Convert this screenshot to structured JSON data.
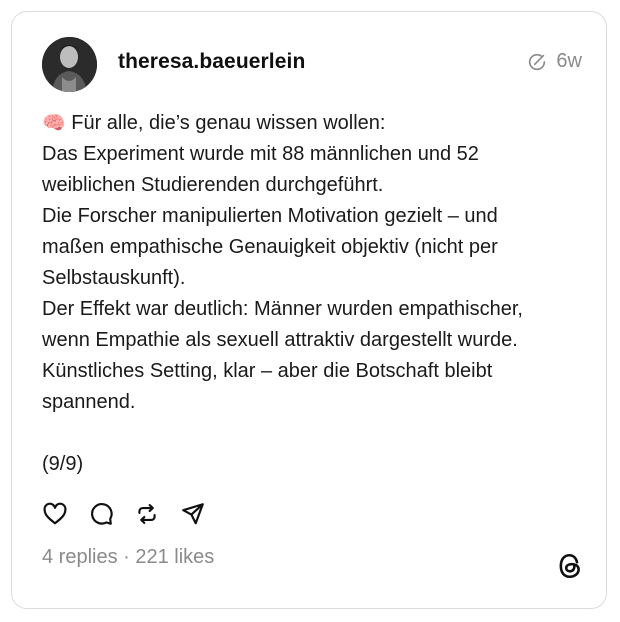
{
  "post": {
    "username": "theresa.baeuerlein",
    "time_ago": "6w",
    "emoji": "🧠",
    "lines": [
      "Für alle, die’s genau wissen wollen:",
      "Das Experiment wurde mit 88 männlichen und 52",
      "weiblichen Studierenden durchgeführt.",
      "Die Forscher manipulierten Motivation gezielt – und",
      "maßen empathische Genauigkeit objektiv (nicht per",
      "Selbstauskunft).",
      "Der Effekt war deutlich: Männer wurden empathischer,",
      "wenn Empathie als sexuell attraktiv dargestellt wurde.",
      "Künstliches Setting, klar – aber die Botschaft bleibt",
      "spannend."
    ],
    "page_counter": "(9/9)",
    "stats": "4 replies · 221 likes"
  },
  "icons": {
    "edited": "edit-circle-icon",
    "like": "heart-icon",
    "reply": "comment-icon",
    "repost": "repost-icon",
    "share": "send-icon",
    "brand": "threads-logo-icon"
  },
  "colors": {
    "text": "#1a1a1a",
    "muted": "#8a8a8a",
    "border": "#dcdcdc"
  }
}
